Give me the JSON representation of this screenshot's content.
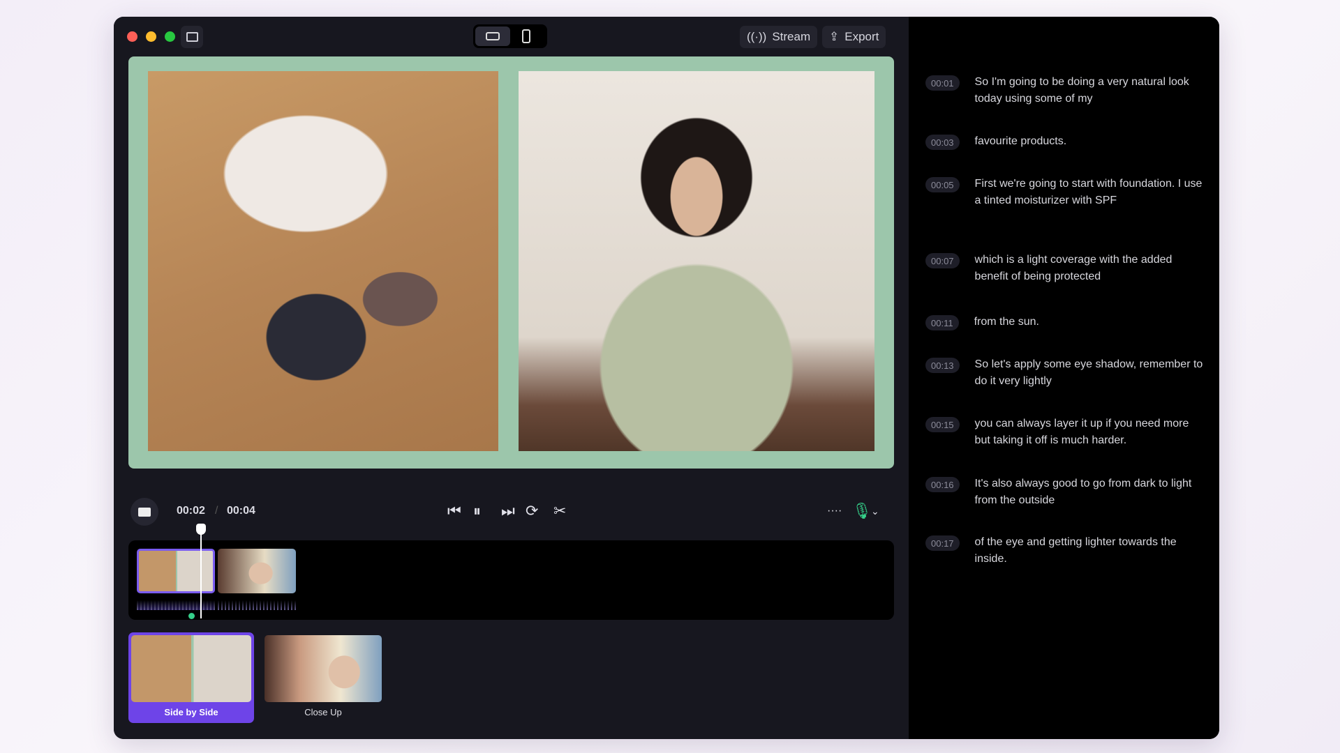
{
  "toolbar": {
    "stream_label": "Stream",
    "export_label": "Export",
    "layout_options": [
      "landscape",
      "portrait"
    ],
    "selected_layout": "landscape"
  },
  "player": {
    "current_time": "00:02",
    "separator": "/",
    "duration": "00:04"
  },
  "layouts": [
    {
      "label": "Side by Side",
      "selected": true
    },
    {
      "label": "Close Up",
      "selected": false
    }
  ],
  "colors": {
    "accent": "#6e44e8",
    "frame": "#9cc6ab",
    "mic": "#35d08a"
  },
  "transcript": [
    {
      "time": "00:01",
      "text": "So I'm going to be doing a very natural look today using some of my"
    },
    {
      "time": "00:03",
      "text": "favourite products."
    },
    {
      "time": "00:05",
      "text": "First we're going to start with foundation. I use a tinted moisturizer with SPF"
    },
    {
      "time": "00:07",
      "text": "which is a light coverage with the added benefit of being protected"
    },
    {
      "time": "00:11",
      "text": "from the sun."
    },
    {
      "time": "00:13",
      "text": "So let's apply some eye shadow, remember to do it very lightly"
    },
    {
      "time": "00:15",
      "text": "you can always layer it up if you need more but taking it off is much harder."
    },
    {
      "time": "00:16",
      "text": "It's also always good to go from dark to light from the outside"
    },
    {
      "time": "00:17",
      "text": "of the eye and getting lighter towards the inside."
    }
  ]
}
